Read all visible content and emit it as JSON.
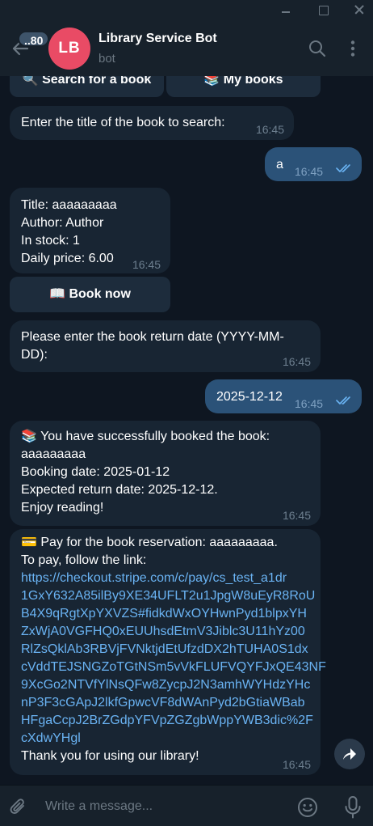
{
  "window": {
    "controls": [
      "minimize",
      "maximize",
      "close"
    ]
  },
  "header": {
    "unread_count": "..80",
    "avatar_initials": "LB",
    "title": "Library Service Bot",
    "subtitle": "bot",
    "avatar_color": "#e94b65"
  },
  "top_keyboard": {
    "search_label": "🔍 Search for a book",
    "mybooks_label": "📚 My books"
  },
  "messages": [
    {
      "dir": "in",
      "lines": [
        "Enter the title of the book to search:"
      ],
      "time": "16:45"
    },
    {
      "dir": "out",
      "lines": [
        "a"
      ],
      "time": "16:45",
      "status": "read"
    },
    {
      "dir": "in",
      "lines": [
        "Title: aaaaaaaaa",
        "Author: Author",
        "In stock: 1",
        "Daily price: 6.00"
      ],
      "time": "16:45",
      "button": "📖 Book now"
    },
    {
      "dir": "in",
      "lines": [
        "Please enter the book return date (YYYY-MM-",
        "DD):"
      ],
      "time": "16:45"
    },
    {
      "dir": "out",
      "lines": [
        "2025-12-12"
      ],
      "time": "16:45",
      "status": "read"
    },
    {
      "dir": "in",
      "lines": [
        "📚 You have successfully booked the book:",
        "aaaaaaaaa",
        "Booking date: 2025-01-12",
        "Expected return date: 2025-12-12.",
        "Enjoy reading!"
      ],
      "time": "16:45"
    },
    {
      "dir": "in",
      "lines": [
        "💳 Pay for the book reservation: aaaaaaaaa.",
        "To pay, follow the link:"
      ],
      "link_lines": [
        "https://checkout.stripe.com/c/pay/cs_test_a1dr",
        "1GxY632A85ilBy9XE34UFLT2u1JpgW8uEyR8RoU",
        "B4X9qRgtXpYXVZS#fidkdWxOYHwnPyd1blpxYH",
        "ZxWjA0VGFHQ0xEUUhsdEtmV3Jiblc3U11hYz00",
        "RlZsQklAb3RBVjFVNktjdEtUfzdDX2hTUHA0S1dx",
        "cVddTEJSNGZoTGtNSm5vVkFLUFVQYFJxQE43NF",
        "9XcGo2NTVfYlNsQFw8ZycpJ2N3amhWYHdzYHc",
        "nP3F3cGApJ2lkfGpwcVF8dWAnPyd2bGtiaWBab",
        "HFgaCcpJ2BrZGdpYFVpZGZgbWppYWB3dic%2F",
        "cXdwYHgl"
      ],
      "footer": "Thank you for using our library!",
      "time": "16:45"
    }
  ],
  "composer": {
    "placeholder": "Write a message..."
  }
}
